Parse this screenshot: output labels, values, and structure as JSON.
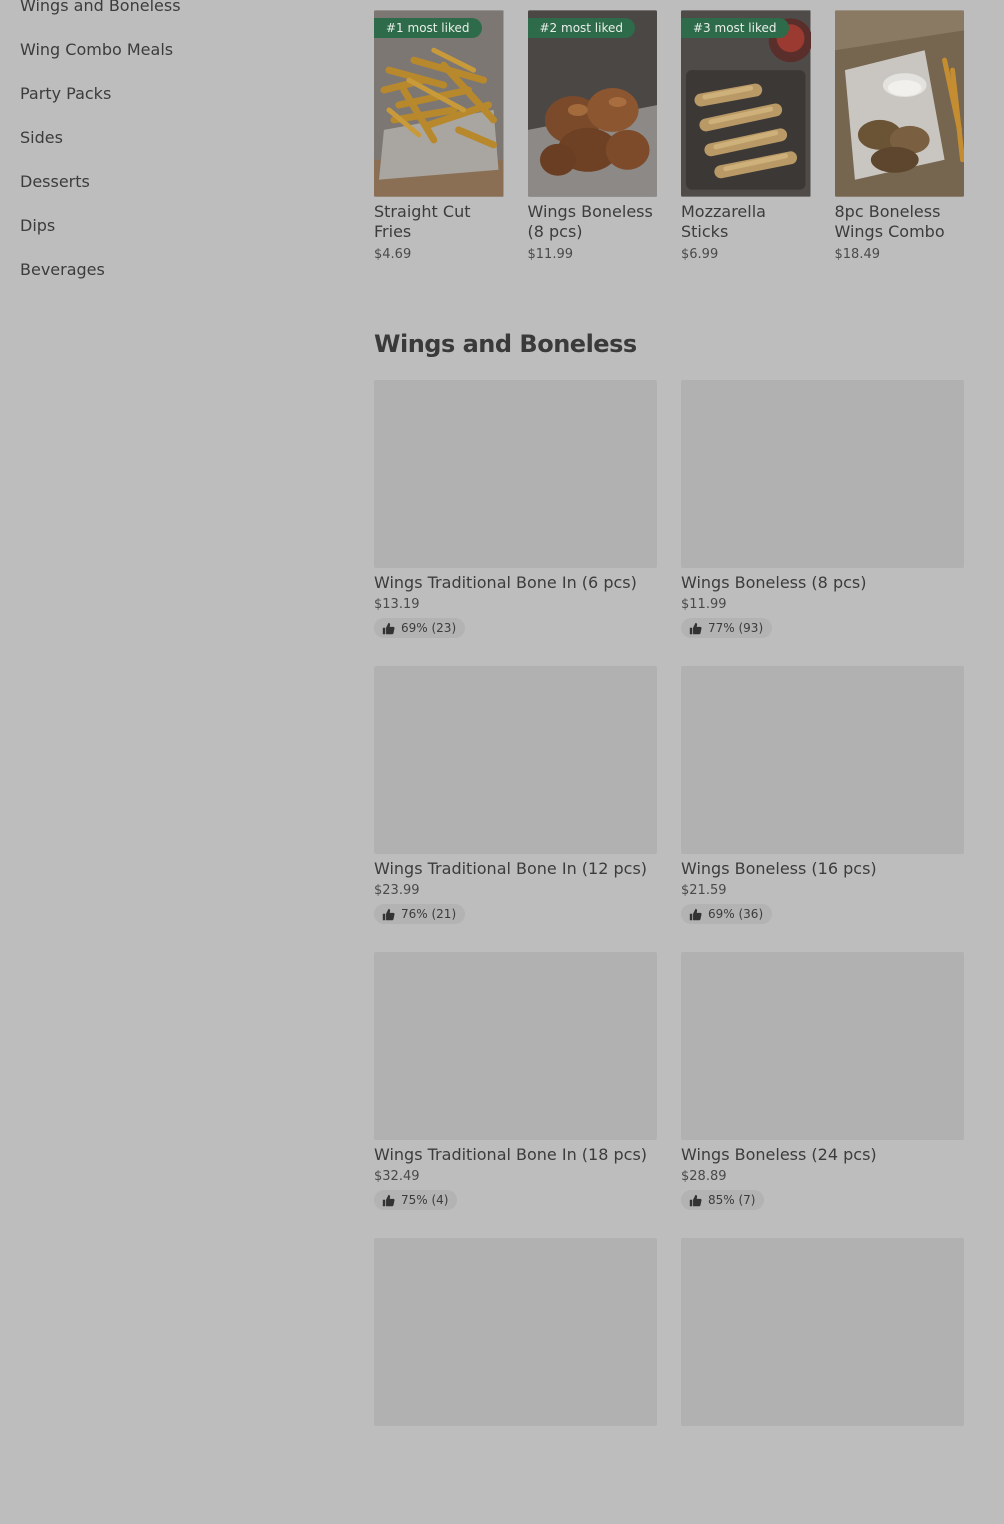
{
  "sidebar": {
    "items": [
      {
        "label": "Wings and Boneless"
      },
      {
        "label": "Wing Combo Meals"
      },
      {
        "label": "Party Packs"
      },
      {
        "label": "Sides"
      },
      {
        "label": "Desserts"
      },
      {
        "label": "Dips"
      },
      {
        "label": "Beverages"
      }
    ]
  },
  "featured": [
    {
      "badge": "#1 most liked",
      "name": "Straight Cut Fries",
      "price": "$4.69"
    },
    {
      "badge": "#2 most liked",
      "name": "Wings Boneless (8 pcs)",
      "price": "$11.99"
    },
    {
      "badge": "#3 most liked",
      "name": "Mozzarella Sticks",
      "price": "$6.99"
    },
    {
      "badge": "",
      "name": "8pc Boneless Wings Combo",
      "price": "$18.49"
    }
  ],
  "section": {
    "title": "Wings and Boneless",
    "items": [
      {
        "name": "Wings Traditional Bone In (6 pcs)",
        "price": "$13.19",
        "rating": "69% (23)"
      },
      {
        "name": "Wings Boneless (8 pcs)",
        "price": "$11.99",
        "rating": "77% (93)"
      },
      {
        "name": "Wings Traditional Bone In (12 pcs)",
        "price": "$23.99",
        "rating": "76% (21)"
      },
      {
        "name": "Wings Boneless (16 pcs)",
        "price": "$21.59",
        "rating": "69% (36)"
      },
      {
        "name": "Wings Traditional Bone In (18 pcs)",
        "price": "$32.49",
        "rating": "75% (4)"
      },
      {
        "name": "Wings Boneless (24 pcs)",
        "price": "$28.89",
        "rating": "85% (7)"
      },
      {
        "name": "",
        "price": "",
        "rating": ""
      },
      {
        "name": "",
        "price": "",
        "rating": ""
      }
    ]
  },
  "colors": {
    "overlay_background": "#bdbdbd",
    "badge_green": "#2e6b4a",
    "placeholder_image": "#b1b1b1"
  },
  "icons": {
    "rating": "thumbs-up-icon"
  }
}
